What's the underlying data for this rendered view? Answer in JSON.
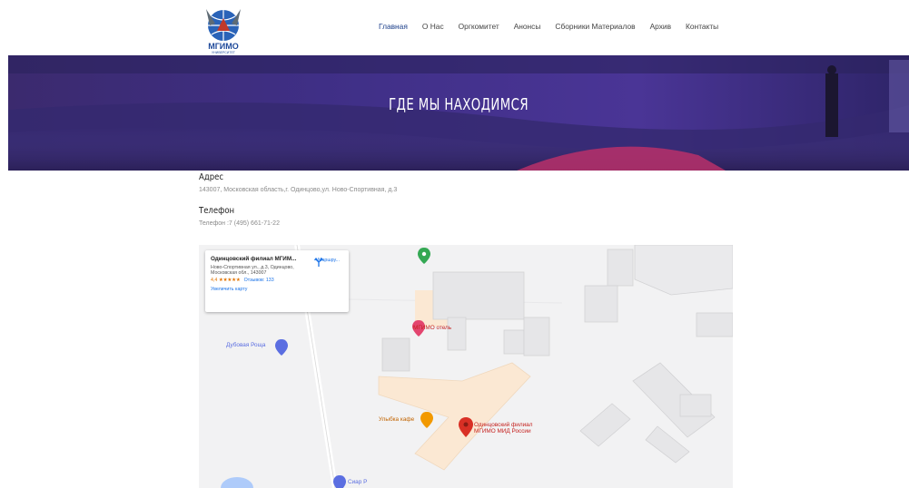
{
  "header": {
    "logo_text": "МГИМО",
    "logo_sub": "УНИВЕРСИТЕТ",
    "nav": [
      "Главная",
      "О Нас",
      "Оргкомитет",
      "Анонсы",
      "Сборники Материалов",
      "Архив",
      "Контакты"
    ]
  },
  "hero": {
    "title": "ГДЕ МЫ НАХОДИМСЯ"
  },
  "address": {
    "heading": "Адрес",
    "text": "143007, Московская область,г. Одинцово,ул. Ново-Спортивная, д.3"
  },
  "phone": {
    "heading": "Телефон",
    "text": "Телефон :7 (495) 661-71-22"
  },
  "map": {
    "card": {
      "title": "Одинцовский филиал МГИМ...",
      "address": "Ново-Спортивная ул., д.3, Одинцово, Московская обл., 143007",
      "rating": "4,4 ★★★★★",
      "reviews": "Отзывов: 133",
      "enlarge": "Увеличить карту",
      "route": "Маршру..."
    },
    "labels": {
      "hotel": "МГИМО отель",
      "grove": "Дубовая Роща",
      "cafe": "Улыбка кафе",
      "branch_line1": "Одинцовский филиал",
      "branch_line2": "МГИМО МИД России",
      "cigar": "Сиар Р"
    },
    "colors": {
      "pin_red": "#d93025",
      "pin_pink": "#e3456f",
      "pin_green": "#34a853",
      "pin_orange": "#f29900",
      "pin_blue": "#5b6ee1"
    }
  }
}
